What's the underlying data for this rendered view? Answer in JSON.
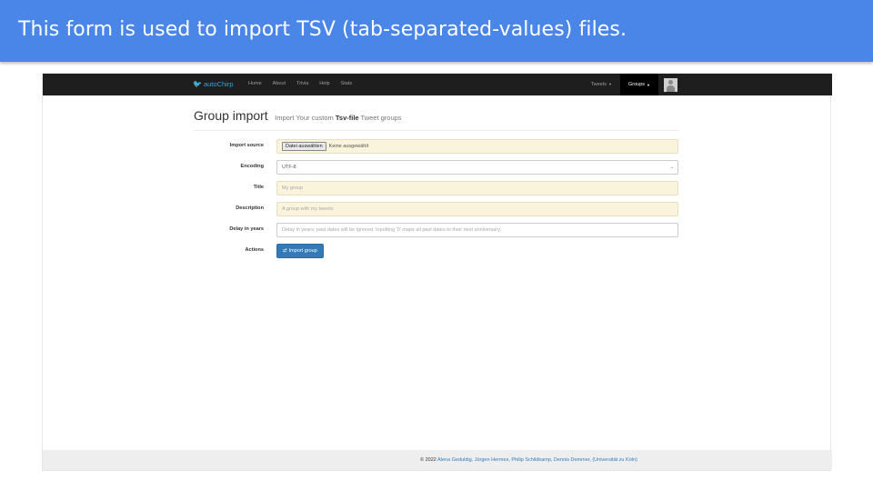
{
  "slide": {
    "title": "This form is used to import TSV (tab-separated-values) files."
  },
  "navbar": {
    "brand": "autoChirp",
    "items": [
      "Home",
      "About",
      "Trivia",
      "Help",
      "Stats"
    ],
    "tweets": "Tweets",
    "groups": "Groups"
  },
  "header": {
    "title": "Group import",
    "subtitle_pre": "Import Your custom",
    "subtitle_bold": "Tsv-file",
    "subtitle_post": "Tweet groups"
  },
  "form": {
    "import_source": {
      "label": "Import source",
      "button": "Datei auswählen",
      "status": "Keine ausgewählt"
    },
    "encoding": {
      "label": "Encoding",
      "value": "UTF-8"
    },
    "title": {
      "label": "Title",
      "placeholder": "My group"
    },
    "description": {
      "label": "Description",
      "placeholder": "A group with my tweets"
    },
    "delay": {
      "label": "Delay in years",
      "placeholder": "Delay in years; past dates will be ignored. Inputting '0' maps all past dates to their next anniversary."
    },
    "actions": {
      "label": "Actions",
      "button": "Import group"
    }
  },
  "footer": {
    "prefix": "© 2022",
    "authors": "Alena Geduldig, Jürgen Hermes, Philip Schildkamp, Dennis Demmer,",
    "institution": "(Universität zu Köln)"
  },
  "colors": {
    "banner": "#4a86e8",
    "navbar": "#1e1e1e",
    "brand": "#2fa4e7",
    "primary": "#337ab7",
    "field_highlight": "#fbf4dc"
  }
}
